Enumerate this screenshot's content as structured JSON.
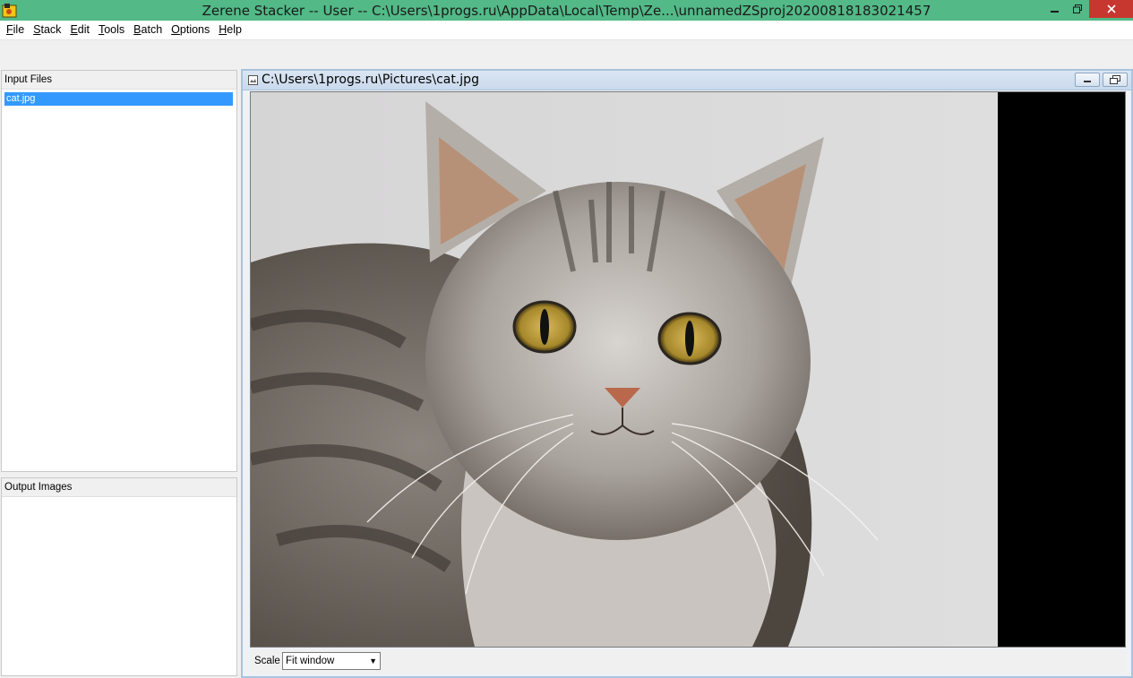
{
  "window": {
    "title": "Zerene Stacker -- User -- C:\\Users\\1progs.ru\\AppData\\Local\\Temp\\Ze...\\unnamedZSproj20200818183021457",
    "accent": "#52b987",
    "close_color": "#c7372f"
  },
  "menu": {
    "items": [
      {
        "label": "File",
        "key": "F",
        "rest": "ile"
      },
      {
        "label": "Stack",
        "key": "S",
        "rest": "tack"
      },
      {
        "label": "Edit",
        "key": "E",
        "rest": "dit"
      },
      {
        "label": "Tools",
        "key": "T",
        "rest": "ools"
      },
      {
        "label": "Batch",
        "key": "B",
        "rest": "atch"
      },
      {
        "label": "Options",
        "key": "O",
        "rest": "ptions"
      },
      {
        "label": "Help",
        "key": "H",
        "rest": "elp"
      }
    ]
  },
  "input_files": {
    "header": "Input Files",
    "items": [
      "cat.jpg"
    ],
    "selected_color": "#3399ff"
  },
  "output_images": {
    "header": "Output Images",
    "items": []
  },
  "image_window": {
    "path": "C:\\Users\\1progs.ru\\Pictures\\cat.jpg",
    "scale_label": "Scale",
    "scale_value": "Fit window"
  },
  "icons": [
    "app-icon",
    "minimize-icon",
    "maximize-icon",
    "close-icon",
    "document-icon",
    "frame-minimize-icon",
    "frame-restore-icon",
    "dropdown-arrow-icon"
  ]
}
